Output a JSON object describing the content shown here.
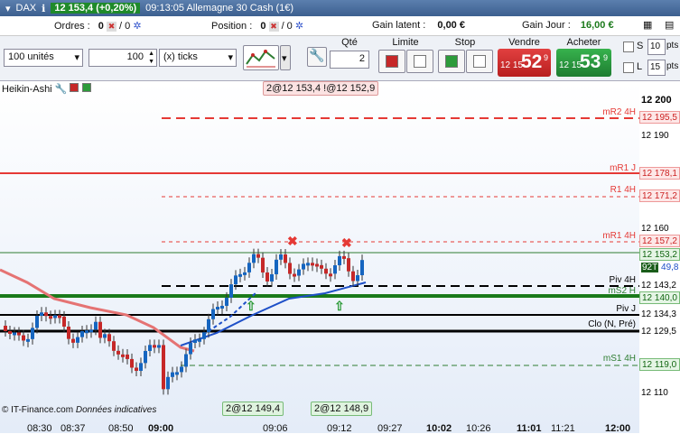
{
  "titlebar": {
    "symbol": "DAX",
    "price_change": "12 153,4 (+0,20%)",
    "time_name": "09:13:05 Allemagne 30 Cash (1€)"
  },
  "infobar": {
    "orders_label": "Ordres :",
    "orders_value": "0",
    "orders_value2": "/ 0",
    "position_label": "Position :",
    "position_value": "0",
    "position_value2": "/ 0",
    "latent_label": "Gain latent :",
    "latent_value": "0,00 €",
    "day_label": "Gain Jour :",
    "day_value": "16,00 €"
  },
  "toolbar": {
    "units": "100 unités",
    "qty_input": "100",
    "ticks": "(x) ticks",
    "qte_label": "Qté",
    "qte_value": "2",
    "limite_label": "Limite",
    "stop_label": "Stop",
    "sell_label": "Vendre",
    "buy_label": "Acheter",
    "sell_prefix": "12 15",
    "sell_big": "52",
    "sell_sup": "9",
    "buy_prefix": "12 15",
    "buy_big": "53",
    "buy_sup": "9",
    "s_label": "S",
    "s_value": "10",
    "l_label": "L",
    "l_value": "15",
    "pts": "pts"
  },
  "chart": {
    "indicator": "Heikin-Ashi",
    "top_tag": "2@12 153,4 !@12 152,9",
    "bottom_tag1": "2@12 149,4",
    "bottom_tag2": "2@12 148,9",
    "copyright": "© IT-Finance.com",
    "disclaimer": "Données indicatives"
  },
  "levels": [
    {
      "name": "mR2 4H",
      "price": "12 195,5",
      "color": "#e53935"
    },
    {
      "name": "mR1 J",
      "price": "12 178,1",
      "color": "#e53935"
    },
    {
      "name": "R1 4H",
      "price": "12 171,2",
      "color": "#e53935"
    },
    {
      "name": "mR1 4H",
      "price": "12 157,2",
      "color": "#e53935"
    },
    {
      "name": "",
      "price": "12 153,2",
      "color": "#2e7d32"
    },
    {
      "name": "Piv 4H",
      "price": "12 143,2",
      "color": "#000000"
    },
    {
      "name": "mS2 H",
      "price": "12 140,0",
      "color": "#2e7d32"
    },
    {
      "name": "Piv J",
      "price": "12 134,3",
      "color": "#000000"
    },
    {
      "name": "Clo (N, Pré)",
      "price": "12 129,5",
      "color": "#000000"
    },
    {
      "name": "mS1 4H",
      "price": "12 119,0",
      "color": "#2e7d32"
    }
  ],
  "axis_labels": [
    "12 200",
    "12 190",
    "12 160",
    "12 110"
  ],
  "axis_marker": {
    "tag": "92T",
    "value": "49,8"
  },
  "time_labels": [
    "08:30",
    "08:37",
    "08:50",
    "09:00",
    "09:06",
    "09:12",
    "09:27",
    "10:02",
    "10:26",
    "11:01",
    "11:21",
    "12:00"
  ],
  "colors": {
    "bull": "#1565c0",
    "bear": "#c62828",
    "ma_red": "#e57373",
    "ma_blue": "#1e50c8"
  }
}
